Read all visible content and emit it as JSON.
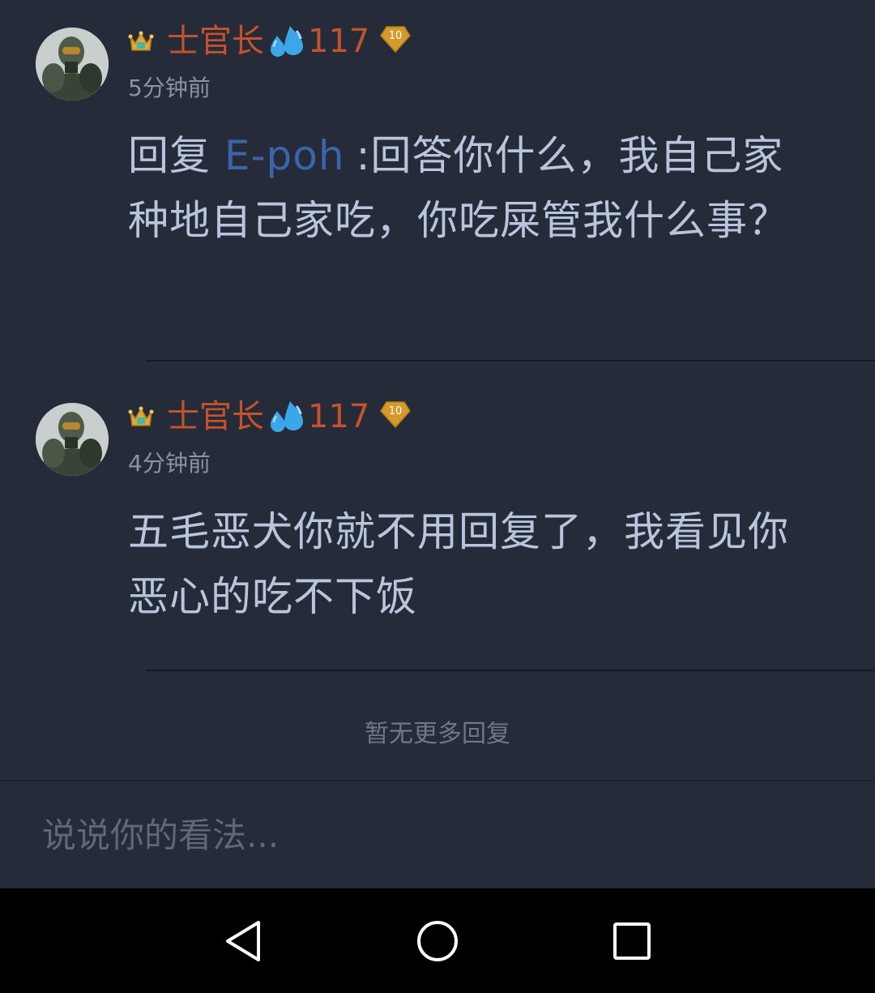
{
  "comments": [
    {
      "username": "士官长",
      "username_suffix": "117",
      "level": "10",
      "time": "5分钟前",
      "reply_prefix": "回复",
      "mention": "E-poh",
      "text": ":回答你什么，我自己家种地自己家吃，你吃屎管我什么事？"
    },
    {
      "username": "士官长",
      "username_suffix": "117",
      "level": "10",
      "time": "4分钟前",
      "text": "五毛恶犬你就不用回复了，我看见你恶心的吃不下饭"
    }
  ],
  "footer": {
    "no_more": "暂无更多回复"
  },
  "input": {
    "placeholder": "说说你的看法..."
  },
  "icons": {
    "crown": "crown-icon",
    "drops": "sweat-drops-emoji-icon",
    "level": "level-badge-icon",
    "back": "back-triangle-icon",
    "home": "home-circle-icon",
    "recent": "recent-apps-square-icon"
  },
  "colors": {
    "background": "#252b38",
    "username": "#c4522d",
    "mention": "#3d63a8",
    "body_text": "#b9c5dc"
  }
}
